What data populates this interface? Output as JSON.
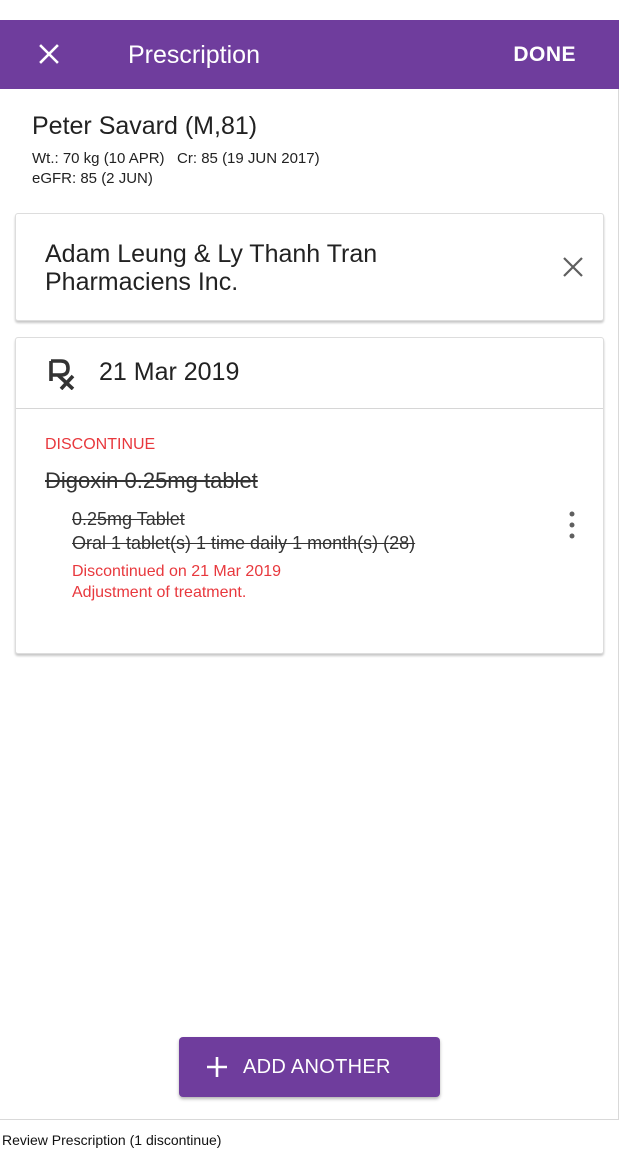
{
  "appbar": {
    "title": "Prescription",
    "done_label": "DONE",
    "close_icon": "close-icon",
    "color": "#6f3d9d"
  },
  "patient": {
    "name": "Peter Savard (M,81)",
    "vitals_line": "Wt.: 70 kg (10 APR)   Cr: 85 (19 JUN 2017)",
    "egfr_line": "eGFR: 85 (2 JUN)"
  },
  "pharmacy": {
    "name": "Adam Leung & Ly Thanh Tran Pharmaciens Inc.",
    "remove_icon": "close-icon"
  },
  "prescription": {
    "rx_icon": "rx-icon",
    "date": "21 Mar 2019",
    "item": {
      "status": "DISCONTINUE",
      "drug": "Digoxin 0.25mg tablet",
      "form": "0.25mg Tablet",
      "directions": "Oral 1 tablet(s) 1 time daily 1 month(s) (28)",
      "discontinued_on": "Discontinued on 21 Mar 2019",
      "reason": "Adjustment of treatment.",
      "menu_icon": "more-vert-icon",
      "alert_color": "#e8383d"
    }
  },
  "add_button": {
    "label": "ADD ANOTHER",
    "icon": "plus-icon"
  },
  "caption": "Review Prescription (1 discontinue)"
}
